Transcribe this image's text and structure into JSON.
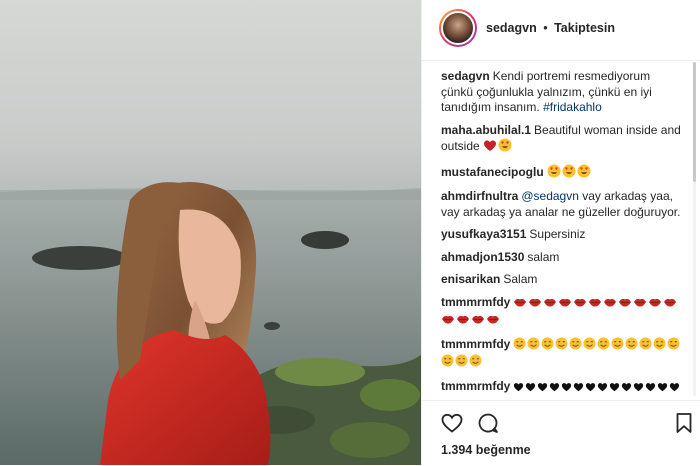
{
  "post": {
    "photo_alt": "photo",
    "author": {
      "username": "sedagvn",
      "separator": "•",
      "follow_state": "Takiptesin"
    },
    "caption": {
      "username": "sedagvn",
      "text": "Kendi portremi resmediyorum çünkü çoğunlukla yalnızım, çünkü en iyi tanıdığım insanım.",
      "hashtag": "#fridakahlo"
    },
    "comments": [
      {
        "username": "maha.abuhilal.1",
        "text": "Beautiful woman inside and outside",
        "emojis": [
          "heart",
          "heart-eyes"
        ]
      },
      {
        "username": "mustafanecipoglu",
        "text": "",
        "emojis": [
          "heart-eyes",
          "heart-eyes",
          "heart-eyes"
        ]
      },
      {
        "username": "ahmdirfnultra",
        "mention": "@sedagvn",
        "text": "vay arkadaş yaa, vay arkadaş ya analar ne güzeller doğuruyor.",
        "emojis": []
      },
      {
        "username": "yusufkaya3151",
        "text": "Supersiniz",
        "emojis": []
      },
      {
        "username": "ahmadjon1530",
        "text": "salam",
        "emojis": []
      },
      {
        "username": "enisarikan",
        "text": "Salam",
        "emojis": []
      },
      {
        "username": "tmmmrmfdy",
        "text": "",
        "emojis": [
          "lips",
          "lips",
          "lips",
          "lips",
          "lips",
          "lips",
          "lips",
          "lips",
          "lips",
          "lips",
          "lips",
          "lips",
          "lips",
          "lips",
          "lips"
        ]
      },
      {
        "username": "tmmmrmfdy",
        "text": "",
        "emojis": [
          "smile",
          "smile",
          "smile",
          "smile",
          "smile",
          "smile",
          "smile",
          "smile",
          "smile",
          "smile",
          "smile",
          "smile",
          "smile",
          "smile",
          "smile"
        ]
      },
      {
        "username": "tmmmrmfdy",
        "text": "",
        "emojis": [
          "black-heart",
          "black-heart",
          "black-heart",
          "black-heart",
          "black-heart",
          "black-heart",
          "black-heart",
          "black-heart",
          "black-heart",
          "black-heart",
          "black-heart",
          "black-heart",
          "black-heart",
          "black-heart",
          "black-heart",
          "black-heart"
        ]
      }
    ],
    "actions": {
      "like_icon": "heart-outline-icon",
      "comment_icon": "comment-bubble-icon",
      "save_icon": "bookmark-icon"
    },
    "likes_text": "1.394 beğenme"
  },
  "colors": {
    "text": "#262626",
    "link": "#003569",
    "border": "#efefef",
    "jacket": "#d42a22"
  }
}
